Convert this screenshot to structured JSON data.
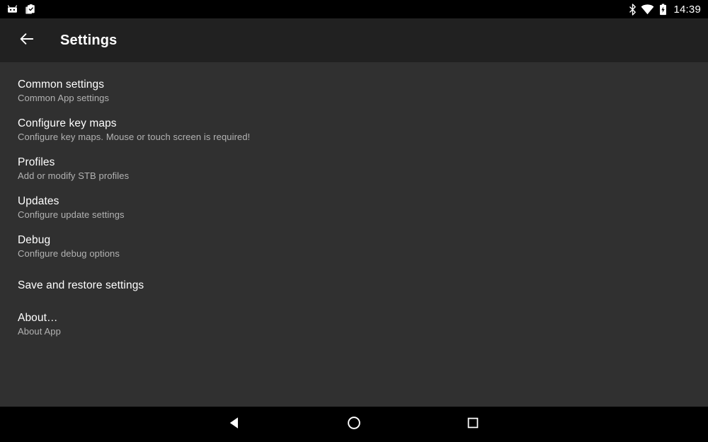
{
  "status_bar": {
    "notification_icons": [
      {
        "name": "app-robot-icon"
      },
      {
        "name": "clipboard-check-icon"
      }
    ],
    "system_icons": [
      {
        "name": "bluetooth-icon"
      },
      {
        "name": "wifi-icon"
      },
      {
        "name": "battery-charging-icon"
      }
    ],
    "clock": "14:39",
    "background_color": "#000000"
  },
  "toolbar": {
    "back_icon": "arrow-left-icon",
    "title": "Settings",
    "background_color": "#212121",
    "title_color": "#ffffff"
  },
  "content": {
    "background_color": "#303030",
    "items": [
      {
        "title": "Common settings",
        "summary": "Common App settings"
      },
      {
        "title": "Configure key maps",
        "summary": "Configure key maps. Mouse or touch screen is required!"
      },
      {
        "title": "Profiles",
        "summary": "Add or modify STB profiles"
      },
      {
        "title": "Updates",
        "summary": "Configure update settings"
      },
      {
        "title": "Debug",
        "summary": "Configure debug options"
      },
      {
        "title": "Save and restore settings",
        "summary": ""
      },
      {
        "title": "About…",
        "summary": "About App"
      }
    ]
  },
  "navigation_bar": {
    "background_color": "#000000",
    "buttons": [
      {
        "name": "nav-back-button",
        "icon": "triangle-left-icon"
      },
      {
        "name": "nav-home-button",
        "icon": "circle-icon"
      },
      {
        "name": "nav-recents-button",
        "icon": "square-icon"
      }
    ]
  }
}
